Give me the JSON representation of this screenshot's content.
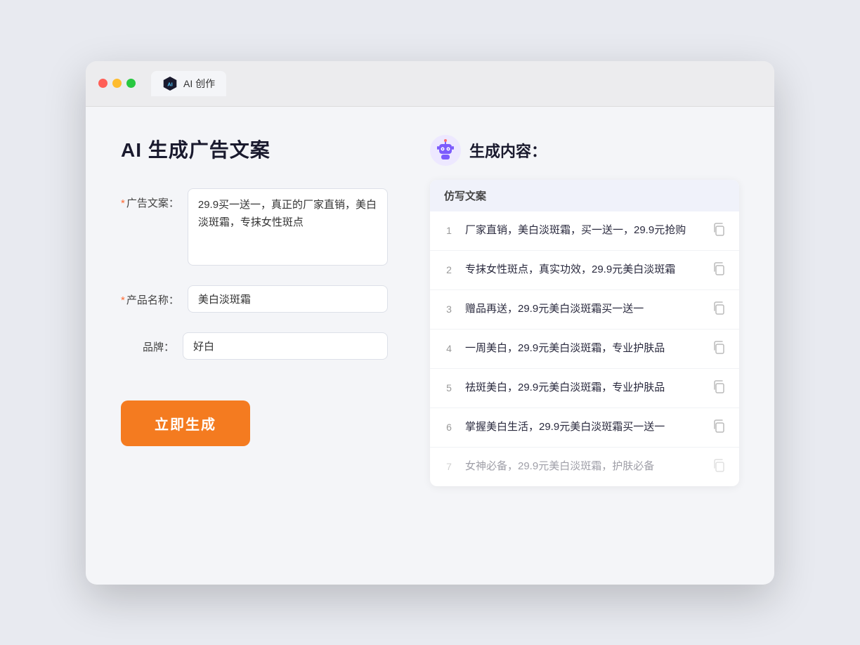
{
  "browser": {
    "tab_label": "AI 创作",
    "traffic_lights": [
      "red",
      "yellow",
      "green"
    ]
  },
  "left_panel": {
    "title": "AI 生成广告文案",
    "form": {
      "ad_copy_label": "广告文案：",
      "ad_copy_required": "*",
      "ad_copy_value": "29.9买一送一，真正的厂家直销，美白淡斑霜，专抹女性斑点",
      "product_name_label": "产品名称：",
      "product_name_required": "*",
      "product_name_value": "美白淡斑霜",
      "brand_label": "品牌：",
      "brand_value": "好白"
    },
    "generate_button": "立即生成"
  },
  "right_panel": {
    "title": "生成内容：",
    "table_header": "仿写文案",
    "results": [
      {
        "num": 1,
        "text": "厂家直销，美白淡斑霜，买一送一，29.9元抢购",
        "muted": false
      },
      {
        "num": 2,
        "text": "专抹女性斑点，真实功效，29.9元美白淡斑霜",
        "muted": false
      },
      {
        "num": 3,
        "text": "赠品再送，29.9元美白淡斑霜买一送一",
        "muted": false
      },
      {
        "num": 4,
        "text": "一周美白，29.9元美白淡斑霜，专业护肤品",
        "muted": false
      },
      {
        "num": 5,
        "text": "祛斑美白，29.9元美白淡斑霜，专业护肤品",
        "muted": false
      },
      {
        "num": 6,
        "text": "掌握美白生活，29.9元美白淡斑霜买一送一",
        "muted": false
      },
      {
        "num": 7,
        "text": "女神必备，29.9元美白淡斑霜，护肤必备",
        "muted": true
      }
    ]
  }
}
